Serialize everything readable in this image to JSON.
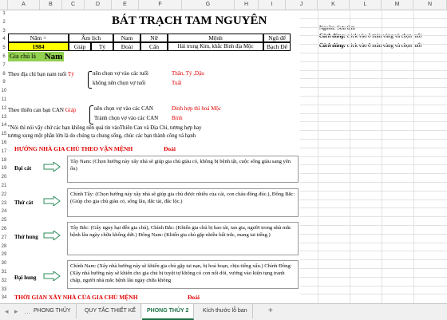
{
  "columns": [
    "A",
    "B",
    "C",
    "D",
    "E",
    "F",
    "G",
    "H",
    "I",
    "J",
    "K",
    "L",
    "M",
    "N"
  ],
  "rows": [
    "1",
    "2",
    "3",
    "4",
    "5",
    "6",
    "7",
    "8",
    "9",
    "10",
    "11",
    "12",
    "13",
    "14",
    "15",
    "16",
    "17",
    "18",
    "19",
    "20",
    "21",
    "22",
    "23",
    "24",
    "25",
    "26",
    "27",
    "28",
    "29",
    "30",
    "31",
    "32",
    "33",
    "34"
  ],
  "sheet": {
    "title": "BÁT TRẠCH TAM NGUYÊN",
    "header": {
      "nam": "Năm =",
      "am_lich": "Âm lịch",
      "nam2": "Nam",
      "nu": "Nữ",
      "menh": "Mệnh",
      "ngu_de": "Ngũ đế"
    },
    "values": {
      "year": "1984",
      "can": "Giáp",
      "chi": "Tý",
      "nam_val": "Đoài",
      "nu_val": "Cấn",
      "menh_val": "Hải trung Kim, khắc Bình địa Mộc",
      "ngu_de_val": "Bạch Đế"
    },
    "gia_chu_label": "Gia chủ là",
    "gia_chu_value": "Nam",
    "dia_chi_prefix": "Theo địa chỉ bạn nam tuổi",
    "dia_chi_tuoi": "Tý",
    "nen_chon_tuoi": "nên chọn vợ vào các tuổi",
    "khong_nen_tuoi": "không nên chọn vợ tuổi",
    "nen_tuoi_val": "Thân, Tý ,Dậu",
    "khong_nen_tuoi_val": "Tuất",
    "thien_can_prefix": "Theo thiên can bạn CAN",
    "thien_can_val": "Giáp",
    "nen_can": "nên chọn vợ vào các CAN",
    "tranh_can": "Tránh chọn vợ vào các CAN",
    "nen_can_val": "Đinh hợp thì hoá Mộc",
    "tranh_can_val": "Bính",
    "note_line1": "\"Nói thì nói vậy chứ các bạn không nên quá tin vàoThiên Can và Địa Chi, tương hợp hay",
    "note_line2": "tương xung một phần lớn là do chúng ta chung sống, chúc các bạn thành công và hạnh",
    "huong_nha_heading": "HƯỚNG NHÀ GIA CHỦ THEO VẬN MỆNH",
    "huong_nha_val": "Đoài",
    "categories": [
      {
        "label": "Đại cát",
        "text": "Tây Nam: (Chọn hướng này xây nhà sẽ giúp gia chủ giàu có, không bị bệnh tật, cuộc sống giàu sang yên ổn)"
      },
      {
        "label": "Thứ cát",
        "text": "Chính Tây: (Chọn hướng này xây nhà sẽ giúp gia chủ được nhiều của cải, con cháu đông đúc.), Đông Bắc: (Giúp cho gia chủ giàu có, sống lâu, đắc tài, đắc lộc.)"
      },
      {
        "label": "Thứ hung",
        "text": "Tây Bắc: (Gây nguy hại đến gia chủ), Chính Bắc: (Khiến gia chủ bị hao tài, tan gia, người trong nhà mắc bệnh lâu ngày chữa không dứt.) Đông Nam: (Khiến gia chủ gặp nhiều bất trắc, mang tai tiếng.)"
      },
      {
        "label": "Đại hung",
        "text": "Chính Nam: (Xây nhà hướng này sẽ khiến gia chủ gặp tai nạn, bị hoả hoạn, chịu tiếng xấu.) Chính Đông: (Xây nhà hướng này sẽ khiến cho gia chủ bị tuyệt tự không có con nối dõi, vương vào kiện tụng tranh chấp, người nhà mắc bệnh lâu ngày chữa không"
      }
    ],
    "thoi_gian_heading": "THỜI GIAN XÂY NHÀ CỦA GIA CHỦ MỆNH",
    "thoi_gian_val": "Đoài",
    "side_source": "Nguồn: Sưu tầm",
    "side_cach_dung_label": "Cách dùng:",
    "side_cach_dung_text": "click vào ô màu vàng và chọn tuổi"
  },
  "tabs": [
    "PHONG THỦY",
    "QUY TẮC THIẾT KẾ",
    "PHONG THỦY 2",
    "Kích thước lỗ ban"
  ],
  "active_tab": "PHONG THỦY 2",
  "add_sheet": "+",
  "colors": {
    "red": "#e00000",
    "yellow": "#ffff00",
    "green": "#92d050",
    "active_tab": "#1e7145"
  }
}
